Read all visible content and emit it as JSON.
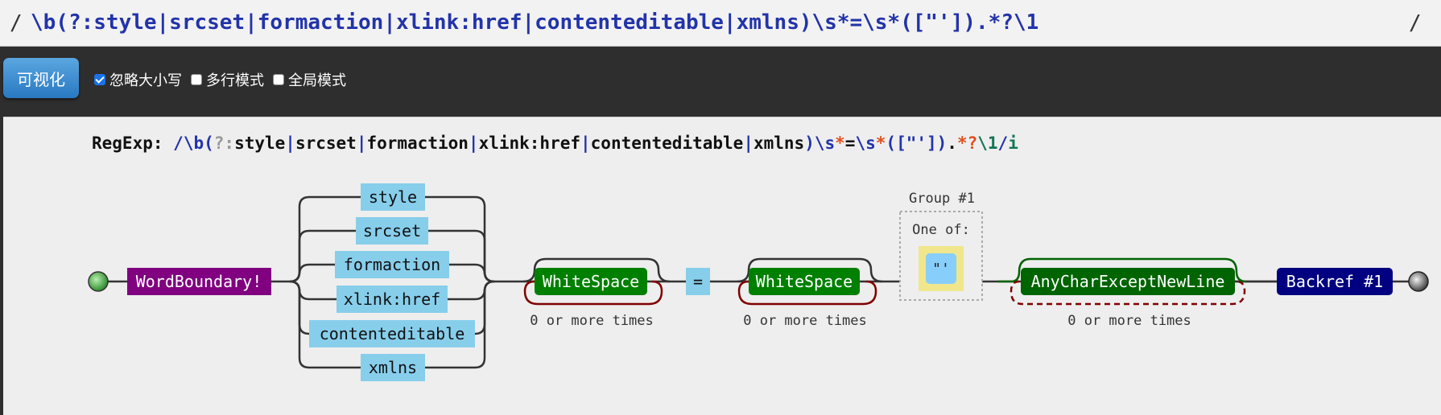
{
  "input": {
    "slash_left": "/",
    "value": "\\b(?:style|srcset|formaction|xlink:href|contenteditable|xmlns)\\s*=\\s*([\"']).*?\\1",
    "slash_right": "/"
  },
  "toolbar": {
    "visualize_label": "可视化",
    "options": [
      {
        "label": "忽略大小写",
        "checked": true
      },
      {
        "label": "多行模式",
        "checked": false
      },
      {
        "label": "全局模式",
        "checked": false
      }
    ]
  },
  "regexp_line": {
    "label": "RegExp:",
    "slash_open": "/",
    "wb": "\\b",
    "grp_open": "(",
    "noncap": "?:",
    "alts": [
      "style",
      "srcset",
      "formaction",
      "xlink:href",
      "contenteditable",
      "xmlns"
    ],
    "pipe": "|",
    "grp_close": ")",
    "ws": "\\s",
    "star": "*",
    "eq": "=",
    "charclass": "[\"']",
    "dot": ".",
    "lazy": "*?",
    "backref": "\\1",
    "slash_close": "/",
    "flags": "i"
  },
  "diagram": {
    "word_boundary": "WordBoundary!",
    "alternatives": [
      "style",
      "srcset",
      "formaction",
      "xlink:href",
      "contenteditable",
      "xmlns"
    ],
    "whitespace": "WhiteSpace",
    "equals": "=",
    "group_label": "Group #1",
    "one_of_label": "One of:",
    "charset": "\"'",
    "any_char": "AnyCharExceptNewLine",
    "backref": "Backref #1",
    "repeat_label": "0 or more times"
  },
  "colors": {
    "word_boundary": "#800080",
    "literal": "#87ceeb",
    "whitespace": "#008000",
    "any_char": "#006400",
    "backref": "#000080",
    "charset_bg": "#f0e68c",
    "loop_red": "#800000",
    "loop_green": "#006400"
  }
}
